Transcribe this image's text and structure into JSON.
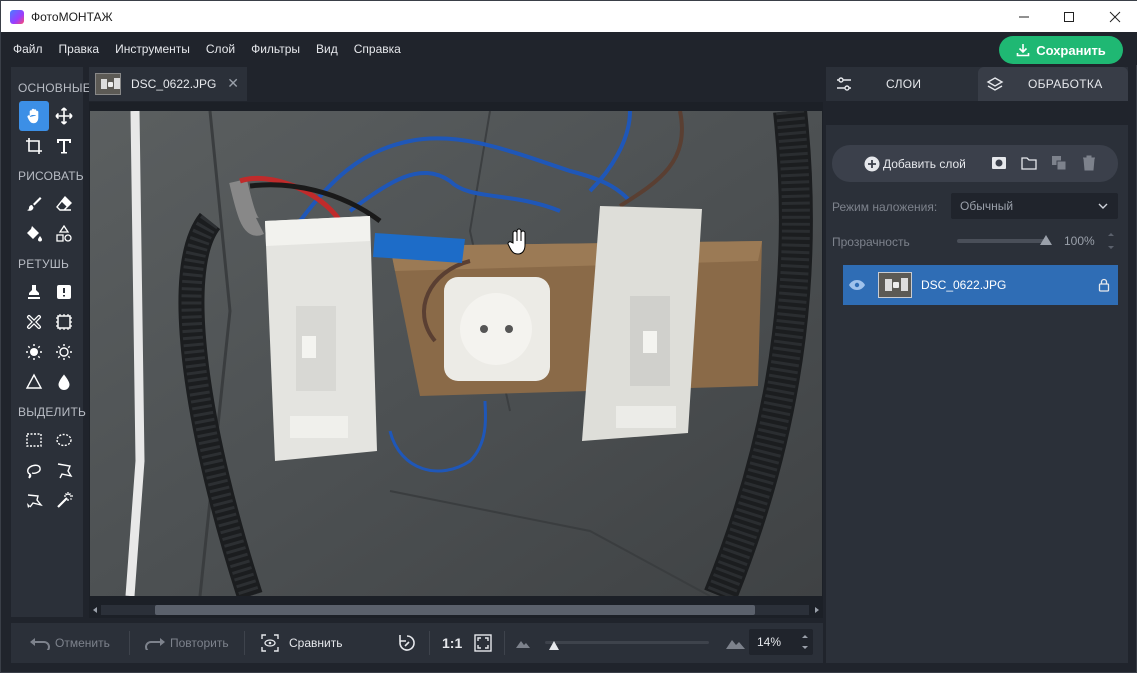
{
  "window": {
    "title": "ФотоМОНТАЖ",
    "controls": {
      "minimize": "—",
      "maximize": "☐",
      "close": "✕"
    }
  },
  "menu": [
    "Файл",
    "Правка",
    "Инструменты",
    "Слой",
    "Фильтры",
    "Вид",
    "Справка"
  ],
  "save_button": {
    "label": "Сохранить",
    "icon": "download-icon",
    "color": "#1fb873"
  },
  "tools": {
    "sections": [
      {
        "title": "ОСНОВНЫЕ",
        "items": [
          "hand-icon",
          "move-icon",
          "crop-icon",
          "text-icon"
        ]
      },
      {
        "title": "РИСОВАТЬ",
        "items": [
          "brush-icon",
          "eraser-icon",
          "fill-icon",
          "shapes-icon"
        ]
      },
      {
        "title": "РЕТУШЬ",
        "items": [
          "stamp-icon",
          "healing-icon",
          "patch-icon",
          "pixel-icon",
          "brighten-icon",
          "darken-icon",
          "sharpen-icon",
          "blur-icon"
        ]
      },
      {
        "title": "ВЫДЕЛИТЬ",
        "items": [
          "rect-select-icon",
          "ellipse-select-icon",
          "lasso-icon",
          "polygon-lasso-icon",
          "magnetic-lasso-icon",
          "magic-wand-icon"
        ]
      }
    ],
    "active": "hand-icon",
    "accent": "#3c8fe6"
  },
  "document_tab": {
    "name": "DSC_0622.JPG",
    "close": "✕"
  },
  "bottom_bar": {
    "undo": "Отменить",
    "redo": "Повторить",
    "compare": "Сравнить",
    "actual_size": "1:1",
    "zoom": "14%"
  },
  "right_panel": {
    "tabs": [
      {
        "label": "СЛОИ",
        "icon": "sliders-icon",
        "active": true
      },
      {
        "label": "ОБРАБОТКА",
        "icon": "layers-icon",
        "active": false
      }
    ],
    "add_layer": "Добавить слой",
    "blend_mode_label": "Режим наложения:",
    "blend_mode_value": "Обычный",
    "opacity_label": "Прозрачность",
    "opacity_value": "100%",
    "layers": [
      {
        "name": "DSC_0622.JPG",
        "visible": true,
        "locked": true,
        "selected": true
      }
    ],
    "selection_color": "#2f6db5"
  }
}
